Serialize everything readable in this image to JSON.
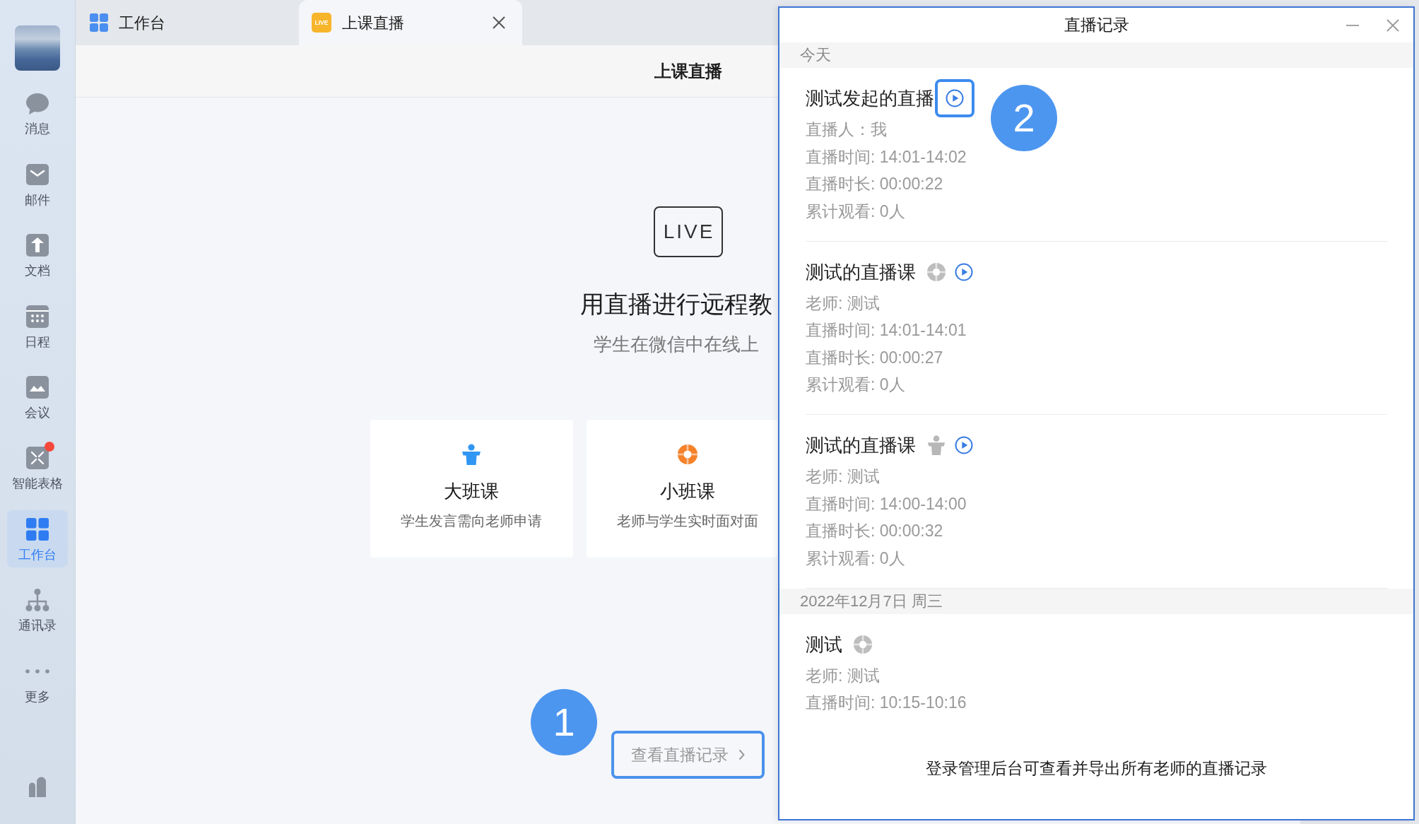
{
  "sidebar": {
    "items": [
      {
        "label": "消息",
        "selected": false,
        "notification": false
      },
      {
        "label": "邮件",
        "selected": false,
        "notification": false
      },
      {
        "label": "文档",
        "selected": false,
        "notification": false
      },
      {
        "label": "日程",
        "selected": false,
        "notification": false
      },
      {
        "label": "会议",
        "selected": false,
        "notification": false
      },
      {
        "label": "智能表格",
        "selected": false,
        "notification": true
      },
      {
        "label": "工作台",
        "selected": true,
        "notification": false
      },
      {
        "label": "通讯录",
        "selected": false,
        "notification": false
      },
      {
        "label": "更多",
        "selected": false,
        "notification": false
      }
    ]
  },
  "tabs": [
    {
      "label": "工作台",
      "selected": false,
      "closable": false
    },
    {
      "label": "上课直播",
      "selected": true,
      "closable": true,
      "icon_text": "LIVE"
    }
  ],
  "page": {
    "title": "上课直播",
    "live_label": "LIVE",
    "headline": "用直播进行远程教",
    "subtitle": "学生在微信中在线上",
    "cards": [
      {
        "kind": "large",
        "title": "大班课",
        "description": "学生发言需向老师申请"
      },
      {
        "kind": "small",
        "title": "小班课",
        "description": "老师与学生实时面对面"
      }
    ],
    "records_button": {
      "label": "查看直播记录",
      "highlighted": true,
      "callout": "1"
    }
  },
  "records_window": {
    "title": "直播记录",
    "sections": [
      {
        "heading": "今天",
        "records": [
          {
            "title": "测试发起的直播",
            "replay": true,
            "replay_highlighted": true,
            "callout": "2",
            "details": [
              "直播人：我",
              "直播时间: 14:01-14:02",
              "直播时长: 00:00:22",
              "累计观看: 0人"
            ]
          },
          {
            "title": "测试的直播课",
            "kind": "small",
            "replay": true,
            "replay_highlighted": false,
            "details": [
              "老师: 测试",
              "直播时间: 14:01-14:01",
              "直播时长: 00:00:27",
              "累计观看: 0人"
            ]
          },
          {
            "title": "测试的直播课",
            "kind": "large",
            "replay": true,
            "replay_highlighted": false,
            "details": [
              "老师: 测试",
              "直播时间: 14:00-14:00",
              "直播时长: 00:00:32",
              "累计观看: 0人"
            ]
          }
        ]
      },
      {
        "heading": "2022年12月7日 周三",
        "records": [
          {
            "title": "测试",
            "kind": "small",
            "replay": false,
            "replay_highlighted": false,
            "details": [
              "老师: 测试",
              "直播时间: 10:15-10:16"
            ]
          }
        ]
      }
    ],
    "footer_note": "登录管理后台可查看并导出所有老师的直播记录"
  }
}
